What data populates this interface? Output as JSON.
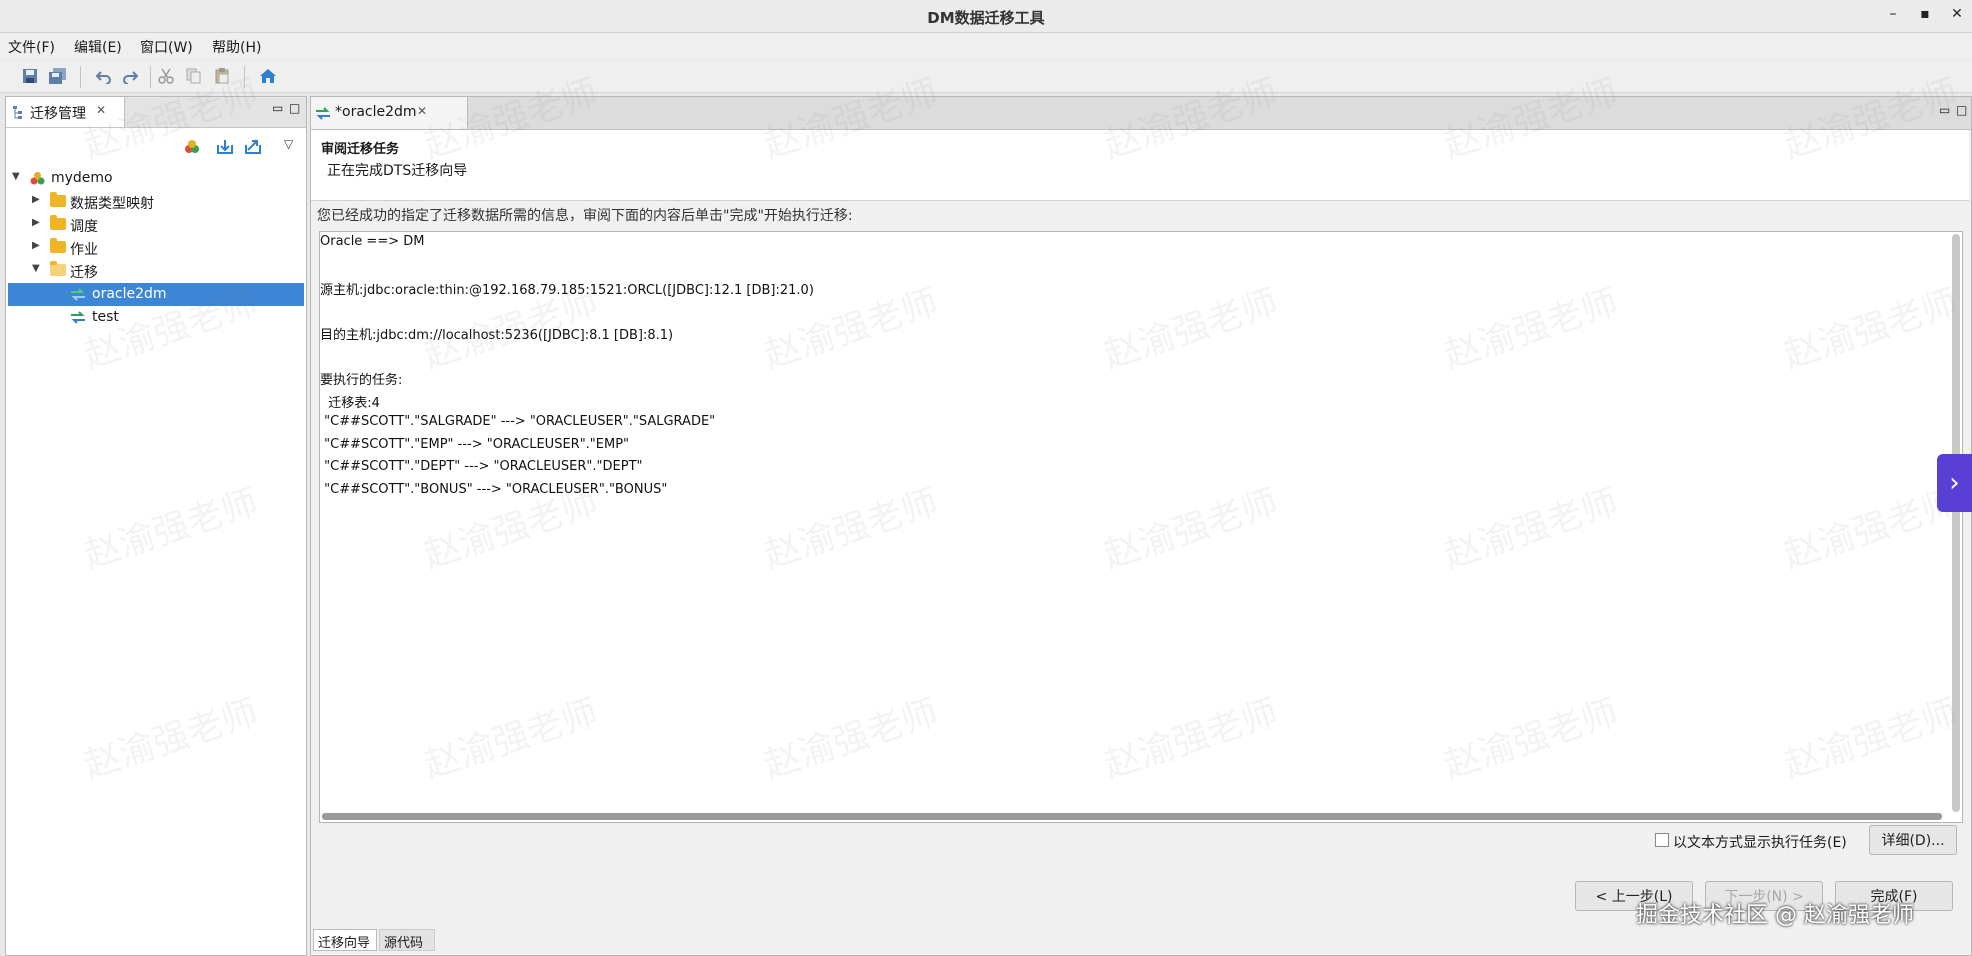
{
  "window": {
    "title": "DM数据迁移工具",
    "controls": [
      "–",
      "▪",
      "✕"
    ]
  },
  "menu": {
    "items": [
      "文件(F)",
      "编辑(E)",
      "窗口(W)",
      "帮助(H)"
    ]
  },
  "left_panel": {
    "tab_label": "迁移管理",
    "tree": [
      {
        "label": "mydemo",
        "level": 0,
        "expanded": true,
        "icon": "project-icon"
      },
      {
        "label": "数据类型映射",
        "level": 1,
        "expanded": false,
        "icon": "folder-icon"
      },
      {
        "label": "调度",
        "level": 1,
        "expanded": false,
        "icon": "folder-icon"
      },
      {
        "label": "作业",
        "level": 1,
        "expanded": false,
        "icon": "folder-icon"
      },
      {
        "label": "迁移",
        "level": 1,
        "expanded": true,
        "icon": "folder-open-icon"
      },
      {
        "label": "oracle2dm",
        "level": 2,
        "selected": true,
        "icon": "migration-icon"
      },
      {
        "label": "test",
        "level": 2,
        "icon": "migration-icon"
      }
    ]
  },
  "editor": {
    "tab_label": "*oracle2dm",
    "header_title": "审阅迁移任务",
    "header_subtitle": "正在完成DTS迁移向导",
    "instruction": "您已经成功的指定了迁移数据所需的信息，审阅下面的内容后单击\"完成\"开始执行迁移:",
    "summary_lines": [
      "Oracle ==> DM",
      "",
      "源主机:jdbc:oracle:thin:@192.168.79.185:1521:ORCL([JDBC]:12.1 [DB]:21.0)",
      "",
      "目的主机:jdbc:dm://localhost:5236([JDBC]:8.1 [DB]:8.1)",
      "",
      "要执行的任务:",
      "  迁移表:4",
      " \"C##SCOTT\".\"SALGRADE\" ---> \"ORACLEUSER\".\"SALGRADE\"",
      " \"C##SCOTT\".\"EMP\" ---> \"ORACLEUSER\".\"EMP\"",
      " \"C##SCOTT\".\"DEPT\" ---> \"ORACLEUSER\".\"DEPT\"",
      " \"C##SCOTT\".\"BONUS\" ---> \"ORACLEUSER\".\"BONUS\""
    ],
    "checkbox_label": "以文本方式显示执行任务(E)",
    "checkbox_checked": false,
    "details_button": "详细(D)...",
    "back_button": "< 上一步(L)",
    "next_button": "下一步(N) >",
    "finish_button": "完成(F)",
    "bottom_tabs": [
      "迁移向导",
      "源代码"
    ]
  },
  "overlay": {
    "watermark": "赵渝强老师",
    "credit": "掘金技术社区 @ 赵渝强老师"
  }
}
